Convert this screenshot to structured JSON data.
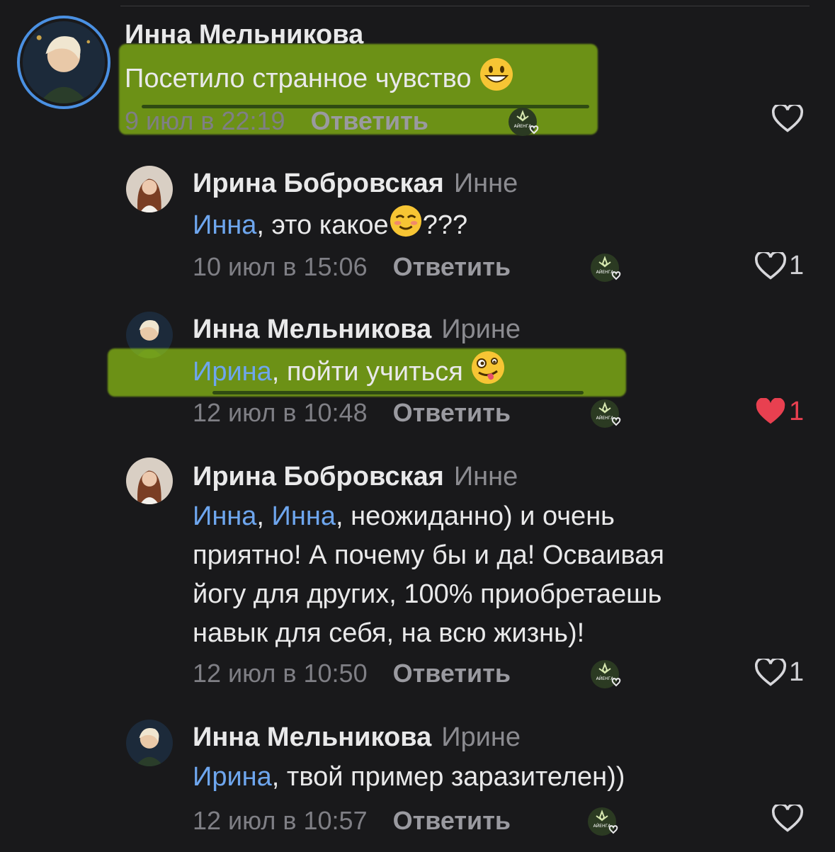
{
  "comments": [
    {
      "author": "Инна Мельникова",
      "reply_to": "",
      "text_plain": "Посетило странное чувство",
      "emoji": "grinning-face",
      "date": "9 июл в 22:19",
      "reply_label": "Ответить",
      "likes": "",
      "liked": false
    },
    {
      "author": "Ирина Бобровская",
      "reply_to": "Инне",
      "mention": "Инна",
      "text_after": ", это какое",
      "emoji": "smiling-face",
      "text_tail": "???",
      "date": "10 июл в 15:06",
      "reply_label": "Ответить",
      "likes": "1",
      "liked": false
    },
    {
      "author": "Инна Мельникова",
      "reply_to": "Ирине",
      "mention": "Ирина",
      "text_after": ", пойти учиться",
      "emoji": "zany-face",
      "date": "12 июл в 10:48",
      "reply_label": "Ответить",
      "likes": "1",
      "liked": true
    },
    {
      "author": "Ирина Бобровская",
      "reply_to": "Инне",
      "mention": "Инна",
      "sep": ", ",
      "mention2": "Инна",
      "line1_after": ", неожиданно) и очень",
      "line2": "приятно! А почему бы и да! Осваивая",
      "line3": "йогу для других, 100% приобретаешь",
      "line4": "навык для себя, на всю жизнь)!",
      "date": "12 июл в 10:50",
      "reply_label": "Ответить",
      "likes": "1",
      "liked": false
    },
    {
      "author": "Инна Мельникова",
      "reply_to": "Ирине",
      "mention": "Ирина",
      "text_after": ", твой пример заразителен))",
      "date": "12 июл в 10:57",
      "reply_label": "Ответить",
      "likes": "",
      "liked": false
    }
  ],
  "colors": {
    "background": "#19191b",
    "mention": "#6ea6ee",
    "highlight": "#a0dc14",
    "liked": "#e84050"
  },
  "icons": {
    "like": "heart-icon",
    "reaction": "community-reaction-icon"
  }
}
